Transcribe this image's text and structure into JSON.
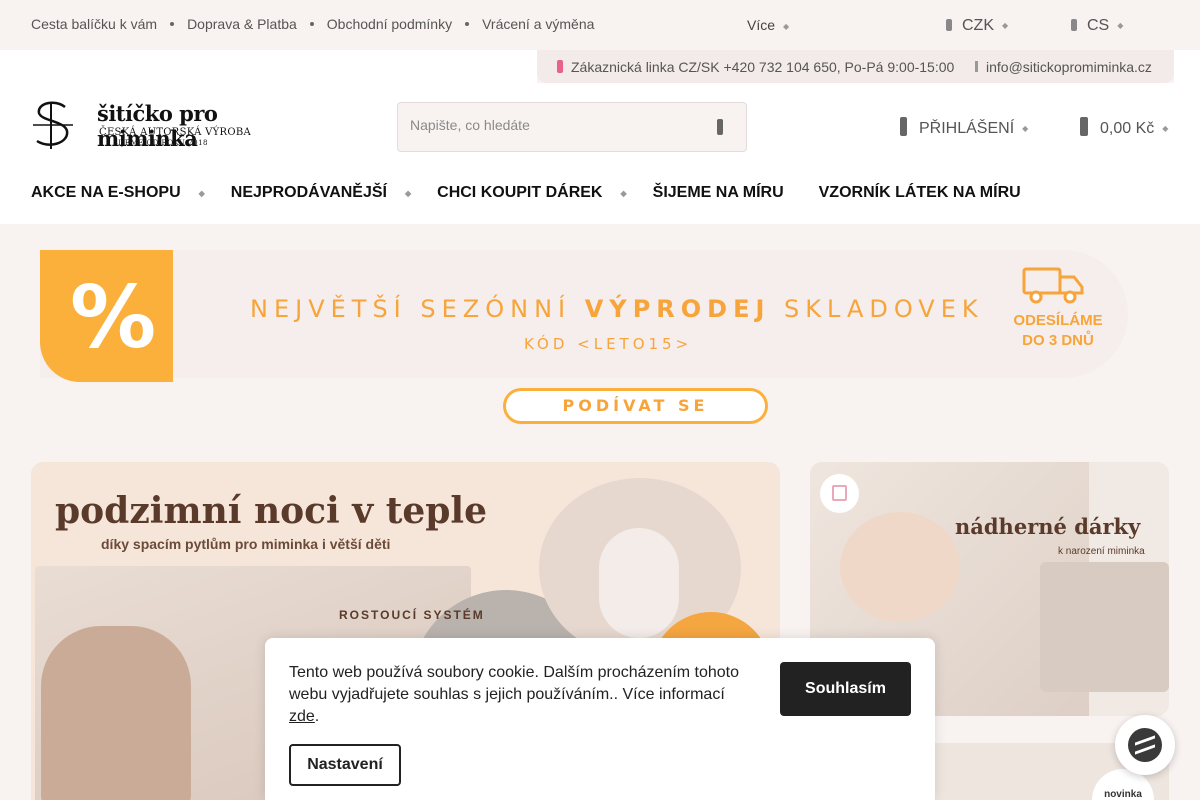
{
  "topbar": {
    "links": [
      "Cesta balíčku k vám",
      "Doprava & Platba",
      "Obchodní podmínky",
      "Vrácení a výměna"
    ],
    "more": "Více",
    "currency": "CZK",
    "language": "CS"
  },
  "contact": {
    "phone": "Zákaznická linka CZ/SK +420 732 104 650, Po-Pá 9:00-15:00",
    "email": "info@sitickopromiminka.cz"
  },
  "logo": {
    "title": "šitíčko pro miminka",
    "sub1": "ČESKÁ AUTORSKÁ VÝROBA",
    "sub2": "ŠIJEME OD ROKU 2018"
  },
  "search": {
    "placeholder": "Napište, co hledáte"
  },
  "account": {
    "login": "PŘIHLÁŠENÍ",
    "cart_total": "0,00 Kč"
  },
  "nav": [
    {
      "label": "AKCE NA E-SHOPU",
      "has_submenu": true
    },
    {
      "label": "NEJPRODÁVANĚJŠÍ",
      "has_submenu": true
    },
    {
      "label": "CHCI KOUPIT DÁREK",
      "has_submenu": true
    },
    {
      "label": "ŠIJEME NA MÍRU",
      "has_submenu": false
    },
    {
      "label": "VZORNÍK LÁTEK NA MÍRU",
      "has_submenu": false
    }
  ],
  "promo": {
    "percent": "%",
    "headline_pre": "NEJVĚTŠÍ SEZÓNNÍ",
    "headline_bold": "VÝPRODEJ",
    "headline_post": "SKLADOVEK",
    "code": "KÓD <LETO15>",
    "ship_line1": "ODESÍLÁME",
    "ship_line2": "DO 3 DNŮ",
    "cta": "PODÍVAT SE"
  },
  "cards": {
    "main_title": "podzimní noci v teple",
    "main_subtitle": "díky spacím pytlům pro miminka i větší děti",
    "main_tag": "ROSTOUCÍ SYSTÉM",
    "right_title": "nádherné dárky",
    "right_subtitle": "k narození miminka",
    "new_badge": "novinka"
  },
  "cookie": {
    "text": "Tento web používá soubory cookie. Dalším procházením tohoto webu vyjadřujete souhlas s jejich používáním.. Více informací",
    "link": "zde",
    "accept": "Souhlasím",
    "settings": "Nastavení"
  },
  "colors": {
    "accent": "#fcb03c",
    "background": "#f8f2f1",
    "dark": "#222222"
  }
}
